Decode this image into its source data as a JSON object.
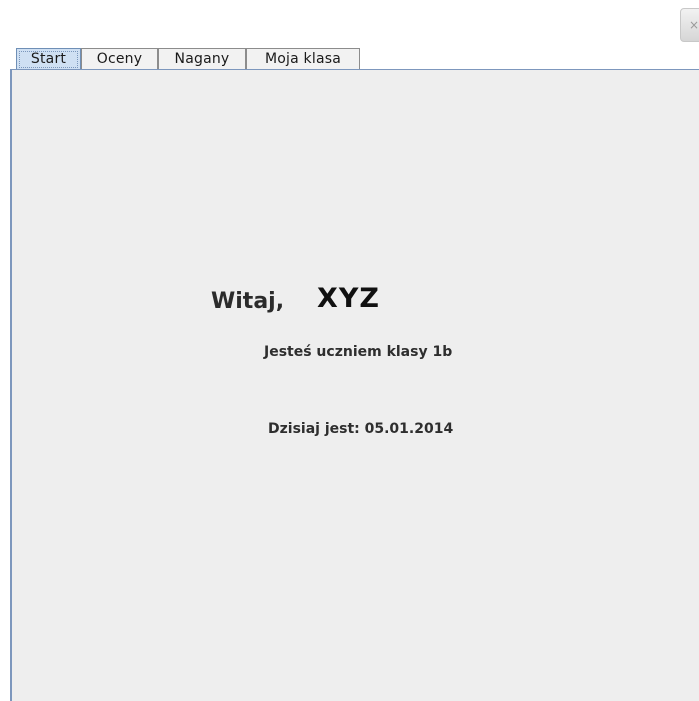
{
  "window": {
    "close_glyph": "×"
  },
  "tabs": [
    {
      "label": "Start",
      "active": true
    },
    {
      "label": "Oceny",
      "active": false
    },
    {
      "label": "Nagany",
      "active": false
    },
    {
      "label": "Moja klasa",
      "active": false
    }
  ],
  "start": {
    "greeting_label": "Witaj,",
    "user_name": "XYZ",
    "class_text": "Jesteś uczniem klasy 1b",
    "date_text": "Dzisiaj jest: 05.01.2014"
  },
  "colors": {
    "active_tab_bg": "#cfe0f3",
    "panel_bg": "#eeeeee",
    "panel_border": "#7d97bd"
  }
}
